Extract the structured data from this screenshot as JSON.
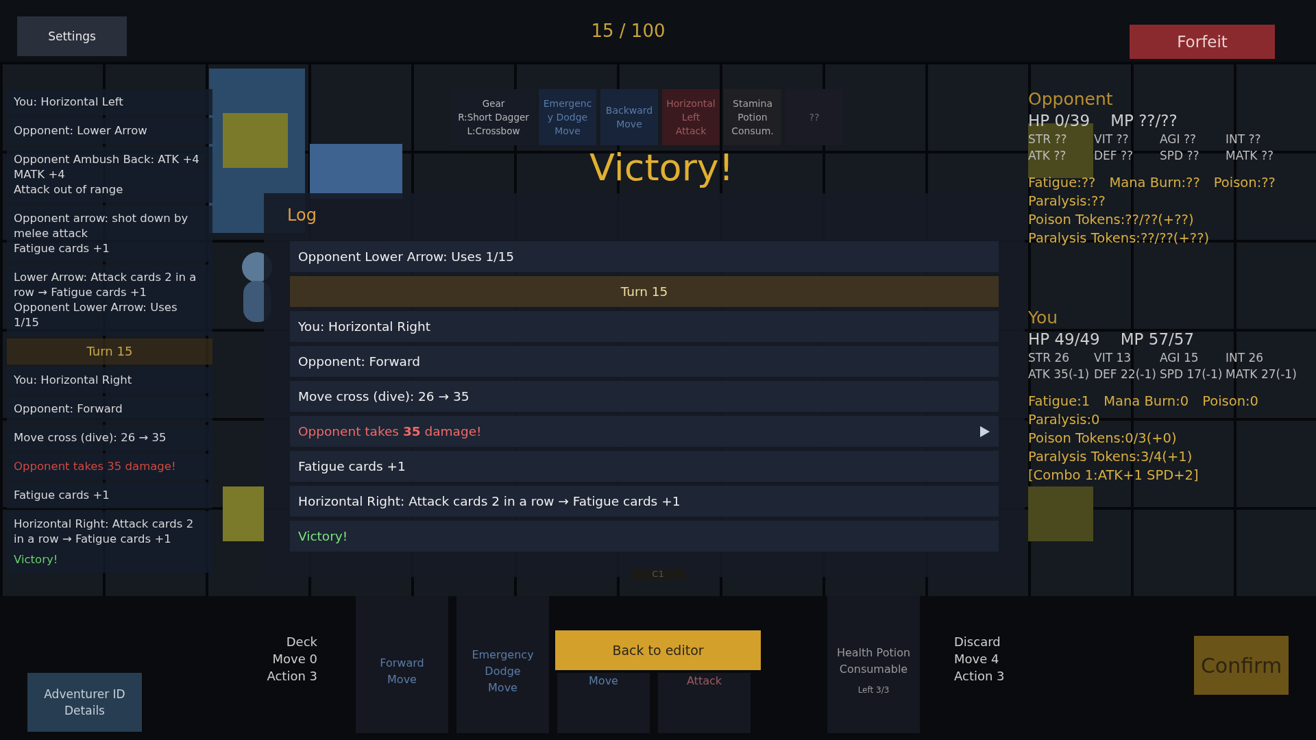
{
  "top_bar": {
    "settings": "Settings",
    "counter": "15 / 100",
    "forfeit": "Forfeit"
  },
  "hand_cards": [
    {
      "kind": "gear",
      "lines": [
        "Gear",
        "R:Short Dagger",
        "L:Crossbow"
      ]
    },
    {
      "kind": "move",
      "lines": [
        "Emergenc",
        "y Dodge",
        "Move"
      ]
    },
    {
      "kind": "move",
      "lines": [
        "Backward",
        "Move"
      ]
    },
    {
      "kind": "attack",
      "lines": [
        "Horizontal",
        "Left",
        "Attack"
      ]
    },
    {
      "kind": "item",
      "lines": [
        "Stamina",
        "Potion",
        "Consum."
      ]
    },
    {
      "kind": "unknown",
      "lines": [
        "??"
      ]
    }
  ],
  "banner": "Victory!",
  "side_log": [
    {
      "kind": "normal",
      "lines": [
        "You: Horizontal Left"
      ]
    },
    {
      "kind": "normal",
      "lines": [
        "Opponent: Lower Arrow"
      ]
    },
    {
      "kind": "normal",
      "lines": [
        "Opponent Ambush Back: ATK +4 MATK +4",
        "Attack out of range"
      ]
    },
    {
      "kind": "normal",
      "lines": [
        "Opponent arrow: shot down by melee attack",
        "Fatigue cards +1"
      ]
    },
    {
      "kind": "normal",
      "lines": [
        "Lower Arrow: Attack cards 2 in a row → Fatigue cards +1",
        "Opponent Lower Arrow: Uses 1/15"
      ]
    },
    {
      "kind": "turn",
      "lines": [
        "Turn 15"
      ]
    },
    {
      "kind": "normal",
      "lines": [
        "You: Horizontal Right"
      ]
    },
    {
      "kind": "normal",
      "lines": [
        "Opponent: Forward"
      ]
    },
    {
      "kind": "normal",
      "lines": [
        "Move cross (dive): 26 → 35"
      ]
    },
    {
      "kind": "damage",
      "lines": [
        "Opponent takes 35 damage!"
      ]
    },
    {
      "kind": "normal",
      "lines": [
        "Fatigue cards +1"
      ]
    },
    {
      "kind": "normal",
      "lines": [
        "Horizontal Right: Attack cards 2 in a row → Fatigue cards +1"
      ]
    },
    {
      "kind": "victory",
      "lines": [
        "Victory!"
      ]
    }
  ],
  "opponent": {
    "title": "Opponent",
    "hp": "HP 0/39",
    "mp": "MP ??/??",
    "stats": [
      "STR ??",
      "VIT ??",
      "AGI ??",
      "INT ??",
      "ATK ??",
      "DEF ??",
      "SPD ??",
      "MATK ??"
    ],
    "statuses": [
      "Fatigue:??",
      "Mana Burn:??",
      "Poison:??",
      "Paralysis:??"
    ],
    "tokens": [
      "Poison Tokens:??/??(+??)",
      "Paralysis Tokens:??/??(+??)"
    ]
  },
  "you": {
    "title": "You",
    "hp": "HP 49/49",
    "mp": "MP 57/57",
    "stats": [
      "STR 26",
      "VIT 13",
      "AGI 15",
      "INT 26",
      "ATK 35(-1)",
      "DEF 22(-1)",
      "SPD 17(-1)",
      "MATK 27(-1)"
    ],
    "statuses": [
      "Fatigue:1",
      "Mana Burn:0",
      "Poison:0",
      "Paralysis:0"
    ],
    "tokens": [
      "Poison Tokens:0/3(+0)",
      "Paralysis Tokens:3/4(+1)",
      "[Combo 1:ATK+1 SPD+2]"
    ]
  },
  "log_dialog": {
    "title": "Log",
    "entries": [
      {
        "kind": "normal",
        "text": "Opponent Lower Arrow: Uses 1/15",
        "arrow": false
      },
      {
        "kind": "turn",
        "text": "Turn 15",
        "arrow": false
      },
      {
        "kind": "normal",
        "text": "You: Horizontal Right",
        "arrow": false
      },
      {
        "kind": "normal",
        "text": "Opponent: Forward",
        "arrow": false
      },
      {
        "kind": "normal",
        "text": "Move cross (dive): 26 → 35",
        "arrow": false
      },
      {
        "kind": "damage",
        "text": "Opponent takes **35** damage!",
        "arrow": true
      },
      {
        "kind": "normal",
        "text": "Fatigue cards +1",
        "arrow": false
      },
      {
        "kind": "normal",
        "text": "Horizontal Right: Attack cards 2 in a row → Fatigue cards +1",
        "arrow": false
      },
      {
        "kind": "victory",
        "text": "Victory!",
        "arrow": false
      }
    ],
    "button": "Back to editor"
  },
  "board_label": "C1",
  "bottom": {
    "adventurer": "Adventurer ID Details",
    "deck": [
      "Deck",
      "Move 0",
      "Action 3"
    ],
    "cards": [
      {
        "kind": "move",
        "lines": [
          "Forward",
          "Move"
        ]
      },
      {
        "kind": "move",
        "lines": [
          "Emergency",
          "Dodge",
          "Move"
        ]
      },
      {
        "kind": "move",
        "lines": [
          "Move"
        ]
      },
      {
        "kind": "attack",
        "lines": [
          "Attack"
        ]
      },
      {
        "kind": "item",
        "lines": [
          "Health Potion",
          "Consumable"
        ],
        "note": "Left 3/3"
      }
    ],
    "discard": [
      "Discard",
      "Move 4",
      "Action 3"
    ],
    "confirm": "Confirm"
  }
}
